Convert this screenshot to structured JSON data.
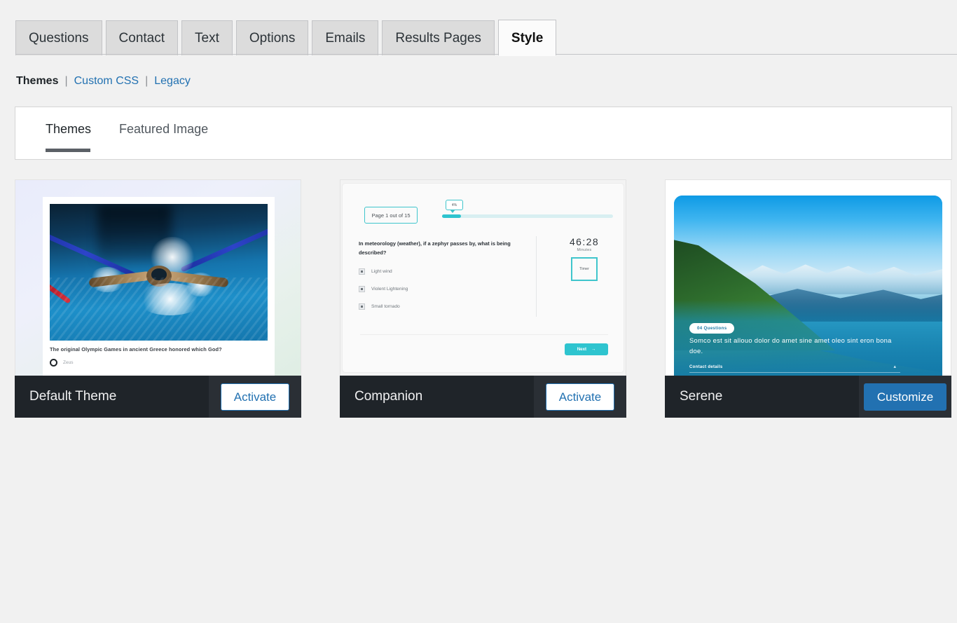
{
  "tabs": [
    {
      "label": "Questions",
      "active": false
    },
    {
      "label": "Contact",
      "active": false
    },
    {
      "label": "Text",
      "active": false
    },
    {
      "label": "Options",
      "active": false
    },
    {
      "label": "Emails",
      "active": false
    },
    {
      "label": "Results Pages",
      "active": false
    },
    {
      "label": "Style",
      "active": true
    }
  ],
  "sublinks": {
    "current": "Themes",
    "sep1": "|",
    "link1": "Custom CSS",
    "sep2": "|",
    "link2": "Legacy"
  },
  "inner_tabs": [
    {
      "label": "Themes",
      "active": true
    },
    {
      "label": "Featured Image",
      "active": false
    }
  ],
  "cards": [
    {
      "name": "Default Theme",
      "action_label": "Activate",
      "action_style": "secondary",
      "preview": {
        "question": "The original Olympic Games in ancient Greece honored which God?",
        "option": "Zeus"
      }
    },
    {
      "name": "Companion",
      "action_label": "Activate",
      "action_style": "secondary",
      "preview": {
        "page_indicator": "Page 1 out of 15",
        "progress_badge": "4%",
        "question": "In meteorology (weather), if a zephyr passes by, what is being described?",
        "options": [
          "Light wind",
          "Violent Lightening",
          "Small tornado"
        ],
        "timer_value": "46:28",
        "timer_unit": "Minutes",
        "timer_label": "Timer",
        "next_label": "Next",
        "next_arrow": "→"
      }
    },
    {
      "name": "Serene",
      "action_label": "Customize",
      "action_style": "primary",
      "preview": {
        "badge": "04 Questions",
        "lead": "Somco est sit allouo dolor do amet sine amet oleo sint eron bona doe.",
        "contact": "Contact details",
        "caret": "▴"
      }
    }
  ],
  "colors": {
    "accent_blue": "#2271b1",
    "teal": "#2ec4cf",
    "footer_dark": "#1f2429",
    "footer_light": "#2a2f35",
    "page_bg": "#f1f1f1"
  }
}
